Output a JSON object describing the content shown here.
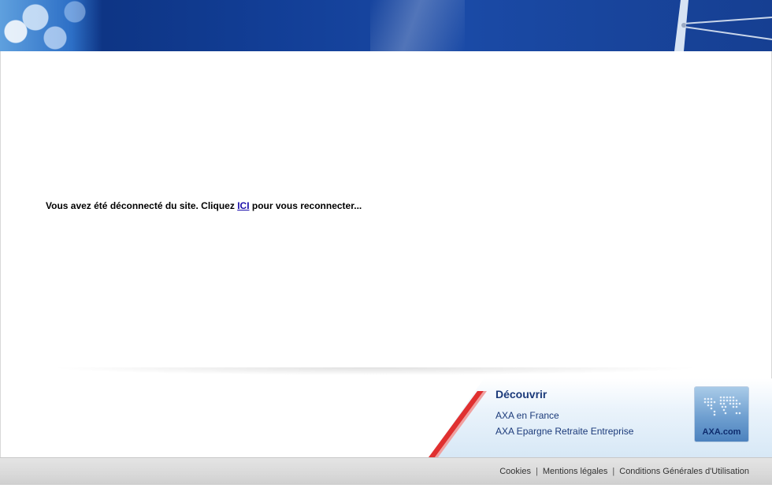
{
  "message": {
    "before": "Vous avez été déconnecté du site. Cliquez ",
    "link": "ICI",
    "after": " pour vous reconnecter..."
  },
  "discover": {
    "title": "Découvrir",
    "links": [
      "AXA en France",
      "AXA Epargne Retraite Entreprise"
    ]
  },
  "badge": {
    "label": "AXA.com",
    "icon": "world-map-icon"
  },
  "footer": {
    "links": [
      "Cookies",
      "Mentions légales",
      "Conditions Générales d'Utilisation"
    ],
    "separator": "|"
  },
  "colors": {
    "banner_blue": "#123e96",
    "link_blue": "#1a0dab",
    "discover_blue": "#1b3a7a",
    "accent_red": "#e03030"
  }
}
